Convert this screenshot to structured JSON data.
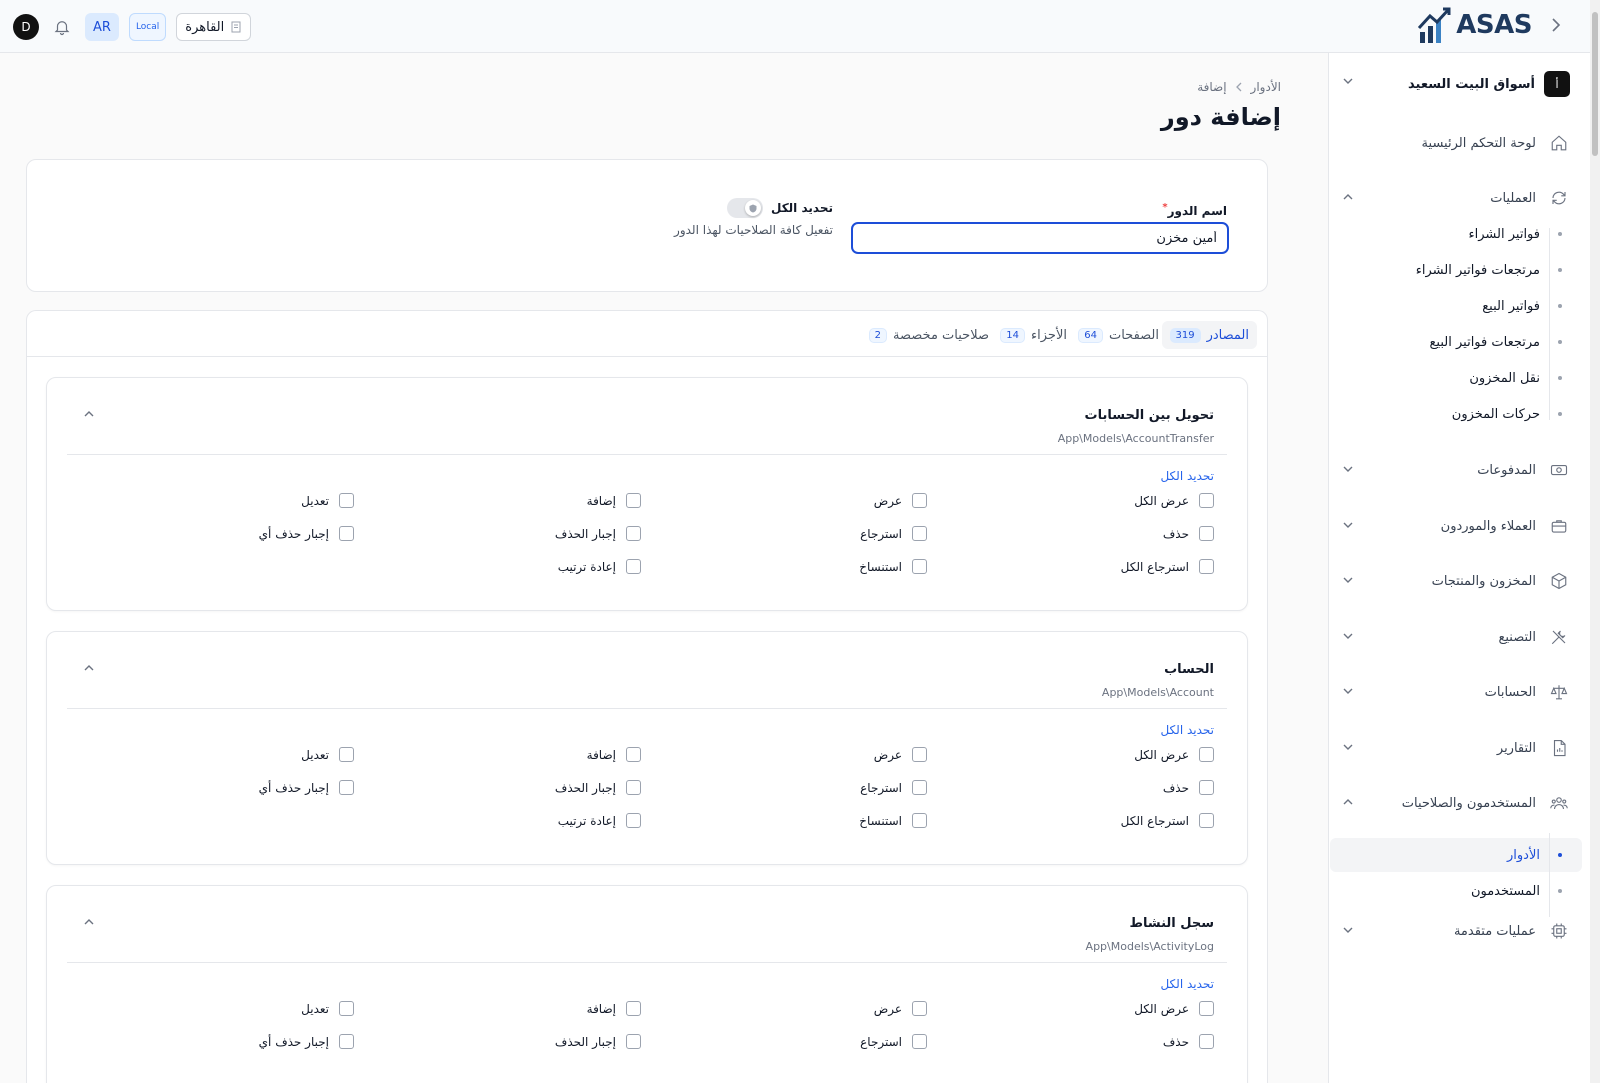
{
  "topbar": {
    "brand": "ASAS",
    "branch": "القاهرة",
    "env": "Local",
    "lang": "AR",
    "avatar_letter": "D"
  },
  "sidebar": {
    "company_initial": "أ",
    "company_name": "أسواق البيت السعيد",
    "items": [
      {
        "label": "لوحة التحكم الرئيسية",
        "icon": "home-icon"
      },
      {
        "label": "العمليات",
        "icon": "refresh-icon",
        "expanded": true
      },
      {
        "label": "المدفوعات",
        "icon": "money-icon"
      },
      {
        "label": "العملاء والموردون",
        "icon": "briefcase-icon"
      },
      {
        "label": "المخزون والمنتجات",
        "icon": "box-icon"
      },
      {
        "label": "التصنيع",
        "icon": "tools-icon"
      },
      {
        "label": "الحسابات",
        "icon": "scale-icon"
      },
      {
        "label": "التقارير",
        "icon": "report-icon"
      },
      {
        "label": "المستخدمون والصلاحيات",
        "icon": "users-icon",
        "expanded": true
      },
      {
        "label": "عمليات متقدمة",
        "icon": "cpu-icon"
      }
    ],
    "operations_sub": [
      "فواتير الشراء",
      "مرتجعات فواتير الشراء",
      "فواتير البيع",
      "مرتجعات فواتير البيع",
      "نقل المخزون",
      "حركات المخزون"
    ],
    "users_sub": [
      "الأدوار",
      "المستخدمون"
    ]
  },
  "breadcrumb": {
    "parent": "الأدوار",
    "current": "إضافة"
  },
  "page_title": "إضافة دور",
  "form": {
    "role_name_label": "اسم الدور",
    "required_mark": "*",
    "role_name_value": "أمين مخزن",
    "select_all_label": "تحديد الكل",
    "select_all_desc": "تفعيل كافة الصلاحيات لهذا الدور"
  },
  "tabs": [
    {
      "label": "المصادر",
      "count": "319",
      "active": true
    },
    {
      "label": "الصفحات",
      "count": "64"
    },
    {
      "label": "الأجزاء",
      "count": "14"
    },
    {
      "label": "صلاحيات مخصصة",
      "count": "2"
    }
  ],
  "select_all_link": "تحديد الكل",
  "permissions": [
    "عرض الكل",
    "عرض",
    "إضافة",
    "تعديل",
    "حذف",
    "استرجاع",
    "إجبار الحذف",
    "إجبار حذف أي",
    "استرجاع الكل",
    "استنساخ",
    "إعادة ترتيب"
  ],
  "sections": [
    {
      "title": "تحويل بين الحسابات",
      "model": "App\\Models\\AccountTransfer"
    },
    {
      "title": "الحساب",
      "model": "App\\Models\\Account"
    },
    {
      "title": "سجل النشاط",
      "model": "App\\Models\\ActivityLog"
    }
  ]
}
